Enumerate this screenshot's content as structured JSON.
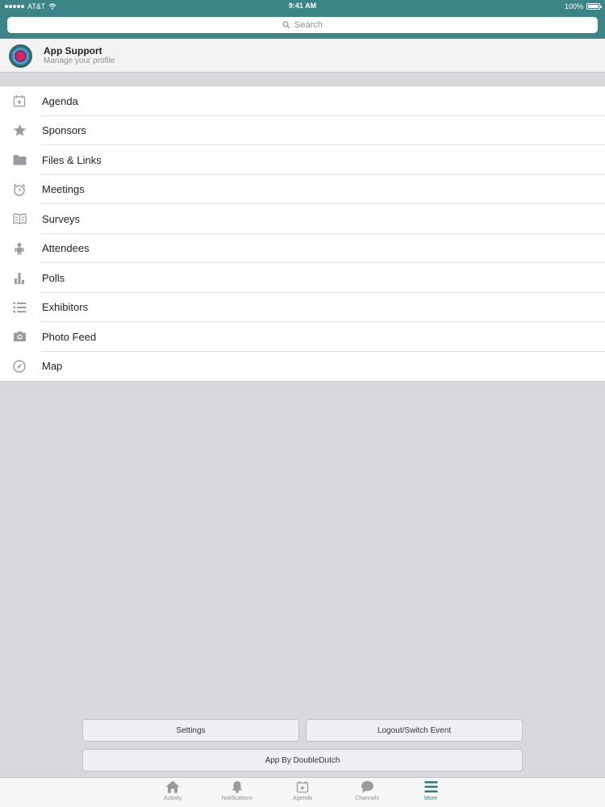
{
  "status": {
    "carrier": "AT&T",
    "time": "9:41 AM",
    "battery": "100%"
  },
  "search": {
    "placeholder": "Search"
  },
  "profile": {
    "name": "App Support",
    "subtitle": "Manage your profile"
  },
  "menu": {
    "items": [
      {
        "label": "Agenda",
        "icon": "calendar-icon"
      },
      {
        "label": "Sponsors",
        "icon": "star-icon"
      },
      {
        "label": "Files & Links",
        "icon": "folder-icon"
      },
      {
        "label": "Meetings",
        "icon": "alarm-clock-icon"
      },
      {
        "label": "Surveys",
        "icon": "book-icon"
      },
      {
        "label": "Attendees",
        "icon": "people-icon"
      },
      {
        "label": "Polls",
        "icon": "bar-chart-icon"
      },
      {
        "label": "Exhibitors",
        "icon": "list-icon"
      },
      {
        "label": "Photo Feed",
        "icon": "camera-icon"
      },
      {
        "label": "Map",
        "icon": "compass-icon"
      }
    ]
  },
  "buttons": {
    "settings": "Settings",
    "logout": "Logout/Switch Event",
    "doubledutch": "App By DoubleDutch"
  },
  "tabs": [
    {
      "label": "Activity",
      "icon": "home-icon"
    },
    {
      "label": "Notifications",
      "icon": "bell-icon"
    },
    {
      "label": "Agenda",
      "icon": "calendar-icon"
    },
    {
      "label": "Channels",
      "icon": "chat-bubble-icon"
    },
    {
      "label": "More",
      "icon": "hamburger-menu-icon"
    }
  ],
  "colors": {
    "header": "#3b8589",
    "active_tab": "#2e7d80",
    "icon_gray": "#9a9aa0"
  }
}
